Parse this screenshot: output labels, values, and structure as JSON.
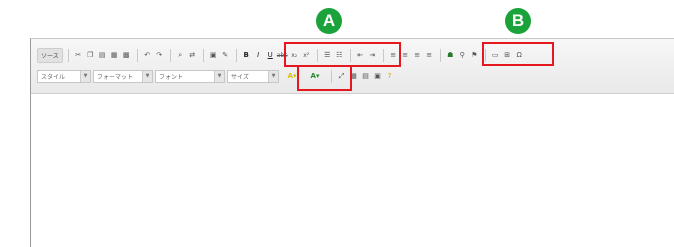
{
  "badges": {
    "a": "A",
    "b": "B"
  },
  "toolbar": {
    "source_label": "ソース",
    "style_label": "スタイル",
    "format_label": "フォーマット",
    "font_label": "フォント",
    "size_label": "サイズ",
    "bold_glyph": "B",
    "italic_glyph": "I",
    "underline_glyph": "U",
    "strike_glyph": "abc",
    "subscript_glyph": "x₂",
    "superscript_glyph": "x²",
    "text_color_glyph": "A",
    "bg_color_glyph": "A"
  },
  "colors": {
    "badge": "#1aa33a",
    "highlight": "#e5181f",
    "text_color": "#d9c000",
    "bg_color": "#2a8a2a"
  }
}
